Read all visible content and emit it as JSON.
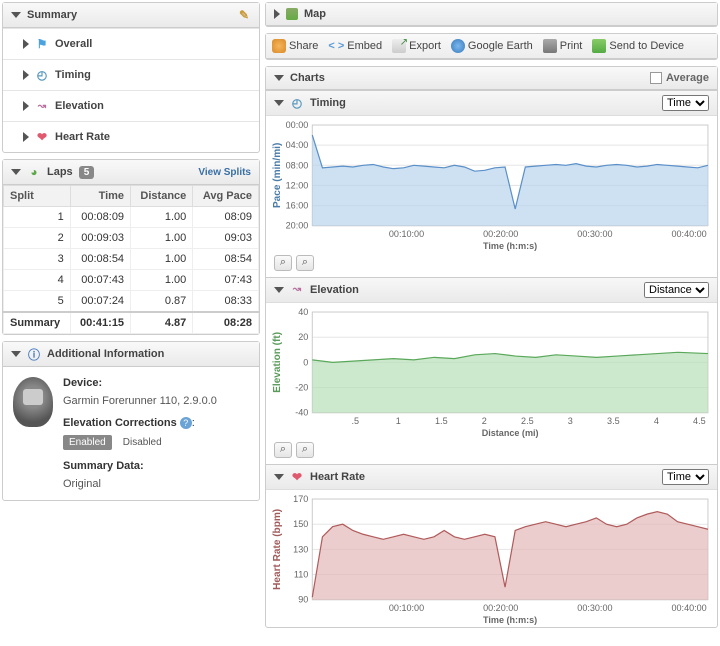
{
  "summary": {
    "title": "Summary",
    "items": [
      "Overall",
      "Timing",
      "Elevation",
      "Heart Rate"
    ]
  },
  "laps": {
    "title": "Laps",
    "count": "5",
    "view_splits": "View Splits",
    "headers": [
      "Split",
      "Time",
      "Distance",
      "Avg Pace"
    ],
    "rows": [
      [
        "1",
        "00:08:09",
        "1.00",
        "08:09"
      ],
      [
        "2",
        "00:09:03",
        "1.00",
        "09:03"
      ],
      [
        "3",
        "00:08:54",
        "1.00",
        "08:54"
      ],
      [
        "4",
        "00:07:43",
        "1.00",
        "07:43"
      ],
      [
        "5",
        "00:07:24",
        "0.87",
        "08:33"
      ]
    ],
    "summary_row": [
      "Summary",
      "00:41:15",
      "4.87",
      "08:28"
    ]
  },
  "additional": {
    "title": "Additional Information",
    "device_label": "Device:",
    "device_value": "Garmin Forerunner 110, 2.9.0.0",
    "elev_corr_label": "Elevation Corrections",
    "enabled": "Enabled",
    "disabled": "Disabled",
    "summary_data_label": "Summary Data:",
    "summary_data_value": "Original"
  },
  "map": {
    "title": "Map"
  },
  "toolbar": {
    "share": "Share",
    "embed": "Embed",
    "export": "Export",
    "google_earth": "Google Earth",
    "print": "Print",
    "send": "Send to Device"
  },
  "charts": {
    "title": "Charts",
    "average": "Average",
    "timing": {
      "title": "Timing",
      "dropdown": "Time"
    },
    "elevation": {
      "title": "Elevation",
      "dropdown": "Distance"
    },
    "heartrate": {
      "title": "Heart Rate",
      "dropdown": "Time"
    }
  },
  "chart_data": [
    {
      "type": "line",
      "name": "timing",
      "title": "Timing",
      "xlabel": "Time (h:m:s)",
      "ylabel": "Pace (min/mi)",
      "y_ticks": [
        "00:00",
        "04:00",
        "08:00",
        "12:00",
        "16:00",
        "20:00"
      ],
      "x_ticks": [
        "00:10:00",
        "00:20:00",
        "00:30:00",
        "00:40:00"
      ],
      "y_range_min_sec": [
        0,
        1200
      ],
      "series": [
        {
          "name": "Pace",
          "color": "#6aa3d6",
          "values_sec": [
            120,
            510,
            500,
            490,
            500,
            480,
            470,
            500,
            520,
            510,
            480,
            490,
            500,
            510,
            480,
            500,
            550,
            540,
            510,
            500,
            1000,
            500,
            490,
            480,
            470,
            480,
            460,
            490,
            500,
            480,
            470,
            480,
            500,
            490,
            470,
            480,
            490,
            500,
            510,
            480
          ]
        }
      ]
    },
    {
      "type": "area",
      "name": "elevation",
      "title": "Elevation",
      "xlabel": "Distance (mi)",
      "ylabel": "Elevation (ft)",
      "y_ticks": [
        -40,
        -20,
        0,
        20,
        40
      ],
      "x_ticks": [
        ".5",
        "1",
        "1.5",
        "2",
        "2.5",
        "3",
        "3.5",
        "4",
        "4.5"
      ],
      "ylim": [
        -40,
        40
      ],
      "series": [
        {
          "name": "Elevation",
          "color": "#7fbf7f",
          "x": [
            0,
            0.25,
            0.5,
            0.75,
            1,
            1.25,
            1.5,
            1.75,
            2,
            2.25,
            2.5,
            2.75,
            3,
            3.25,
            3.5,
            3.75,
            4,
            4.25,
            4.5,
            4.87
          ],
          "y": [
            2,
            0,
            1,
            2,
            3,
            2,
            4,
            3,
            6,
            7,
            5,
            4,
            6,
            5,
            4,
            5,
            6,
            7,
            8,
            7
          ]
        }
      ]
    },
    {
      "type": "area",
      "name": "heartrate",
      "title": "Heart Rate",
      "xlabel": "Time (h:m:s)",
      "ylabel": "Heart Rate (bpm)",
      "y_ticks": [
        90,
        110,
        130,
        150,
        170
      ],
      "x_ticks": [
        "00:10:00",
        "00:20:00",
        "00:30:00",
        "00:40:00"
      ],
      "ylim": [
        90,
        170
      ],
      "series": [
        {
          "name": "HR",
          "color": "#c06a6a",
          "values": [
            92,
            140,
            148,
            150,
            145,
            142,
            140,
            138,
            140,
            142,
            140,
            138,
            140,
            145,
            140,
            138,
            140,
            142,
            140,
            100,
            145,
            148,
            150,
            152,
            150,
            148,
            150,
            152,
            155,
            150,
            148,
            150,
            155,
            158,
            160,
            158,
            152,
            150,
            148,
            146
          ]
        }
      ]
    }
  ]
}
